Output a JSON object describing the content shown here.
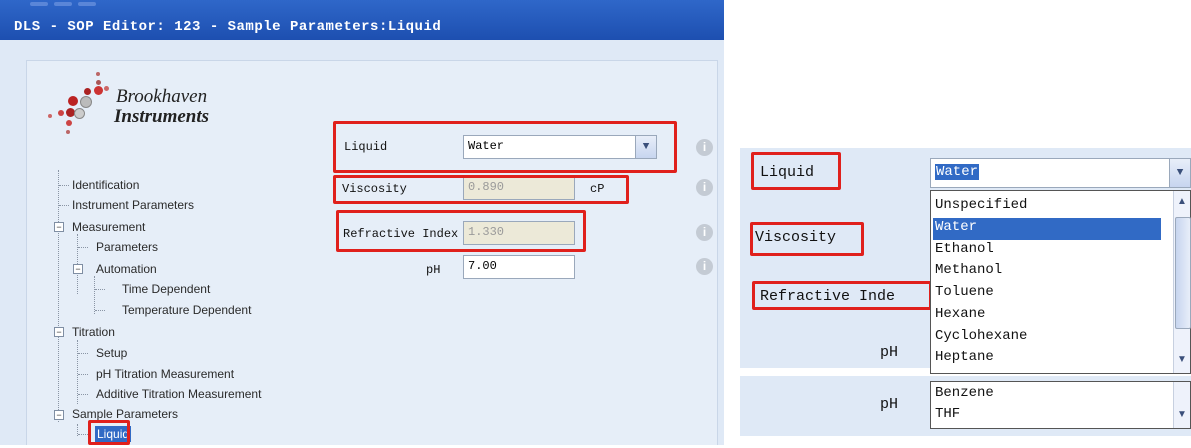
{
  "window": {
    "title": "DLS - SOP Editor: 123 - Sample Parameters:Liquid"
  },
  "logo": {
    "line1": "Brookhaven",
    "line2": "Instruments"
  },
  "tree": [
    {
      "label": "Identification"
    },
    {
      "label": "Instrument Parameters"
    },
    {
      "label": "Measurement"
    },
    {
      "label": "Parameters"
    },
    {
      "label": "Automation"
    },
    {
      "label": "Time Dependent"
    },
    {
      "label": "Temperature Dependent"
    },
    {
      "label": "Titration"
    },
    {
      "label": "Setup"
    },
    {
      "label": "pH Titration Measurement"
    },
    {
      "label": "Additive Titration Measurement"
    },
    {
      "label": "Sample Parameters"
    },
    {
      "label": "Liquid"
    }
  ],
  "form": {
    "liquid_label": "Liquid",
    "liquid_value": "Water",
    "viscosity_label": "Viscosity",
    "viscosity_value": "0.890",
    "viscosity_unit": "cP",
    "ri_label": "Refractive Index",
    "ri_value": "1.330",
    "ph_label": "pH",
    "ph_value": "7.00",
    "info_glyph": "i"
  },
  "zoom": {
    "liquid_label": "Liquid",
    "liquid_value": "Water",
    "viscosity_label": "Viscosity",
    "ri_label": "Refractive Inde",
    "ph_label": "pH",
    "ph_label2": "pH",
    "options": [
      "Unspecified",
      "Water",
      "Ethanol",
      "Methanol",
      "Toluene",
      "Hexane",
      "Cyclohexane",
      "Heptane"
    ],
    "selected": "Water",
    "options_second": [
      "Benzene",
      "THF"
    ]
  },
  "colors": {
    "highlight": "#e0201c",
    "title_bar": "#2558bd",
    "selection": "#316ac5"
  }
}
